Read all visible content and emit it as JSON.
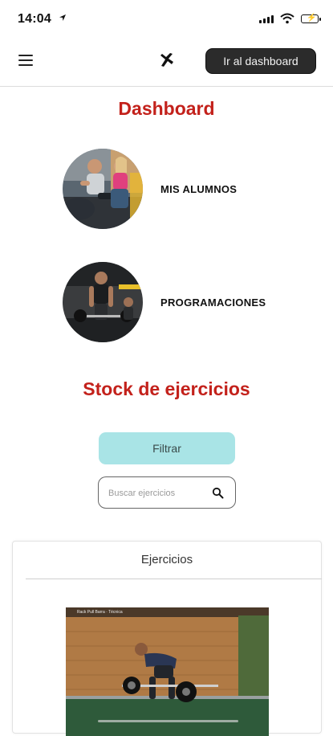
{
  "status_bar": {
    "time": "14:04",
    "location_icon": "location-arrow-icon",
    "signal_icon": "cellular-signal-icon",
    "wifi_icon": "wifi-icon",
    "battery_icon": "battery-charging-icon"
  },
  "nav": {
    "menu_icon": "hamburger-menu-icon",
    "logo_icon": "brand-logo-icon",
    "dashboard_button": "Ir al dashboard"
  },
  "dashboard": {
    "title": "Dashboard",
    "items": [
      {
        "label": "MIS ALUMNOS"
      },
      {
        "label": "PROGRAMACIONES"
      }
    ]
  },
  "stock": {
    "title": "Stock de ejercicios",
    "filter_button": "Filtrar",
    "search_placeholder": "Buscar ejercicios",
    "search_icon": "search-icon"
  },
  "card": {
    "title": "Ejercicios",
    "video_title": "Rack Pull Barra · Técnica"
  },
  "colors": {
    "accent_red": "#c3211b",
    "filter_bg": "#a9e4e6",
    "dark_button": "#2b2b2b"
  }
}
